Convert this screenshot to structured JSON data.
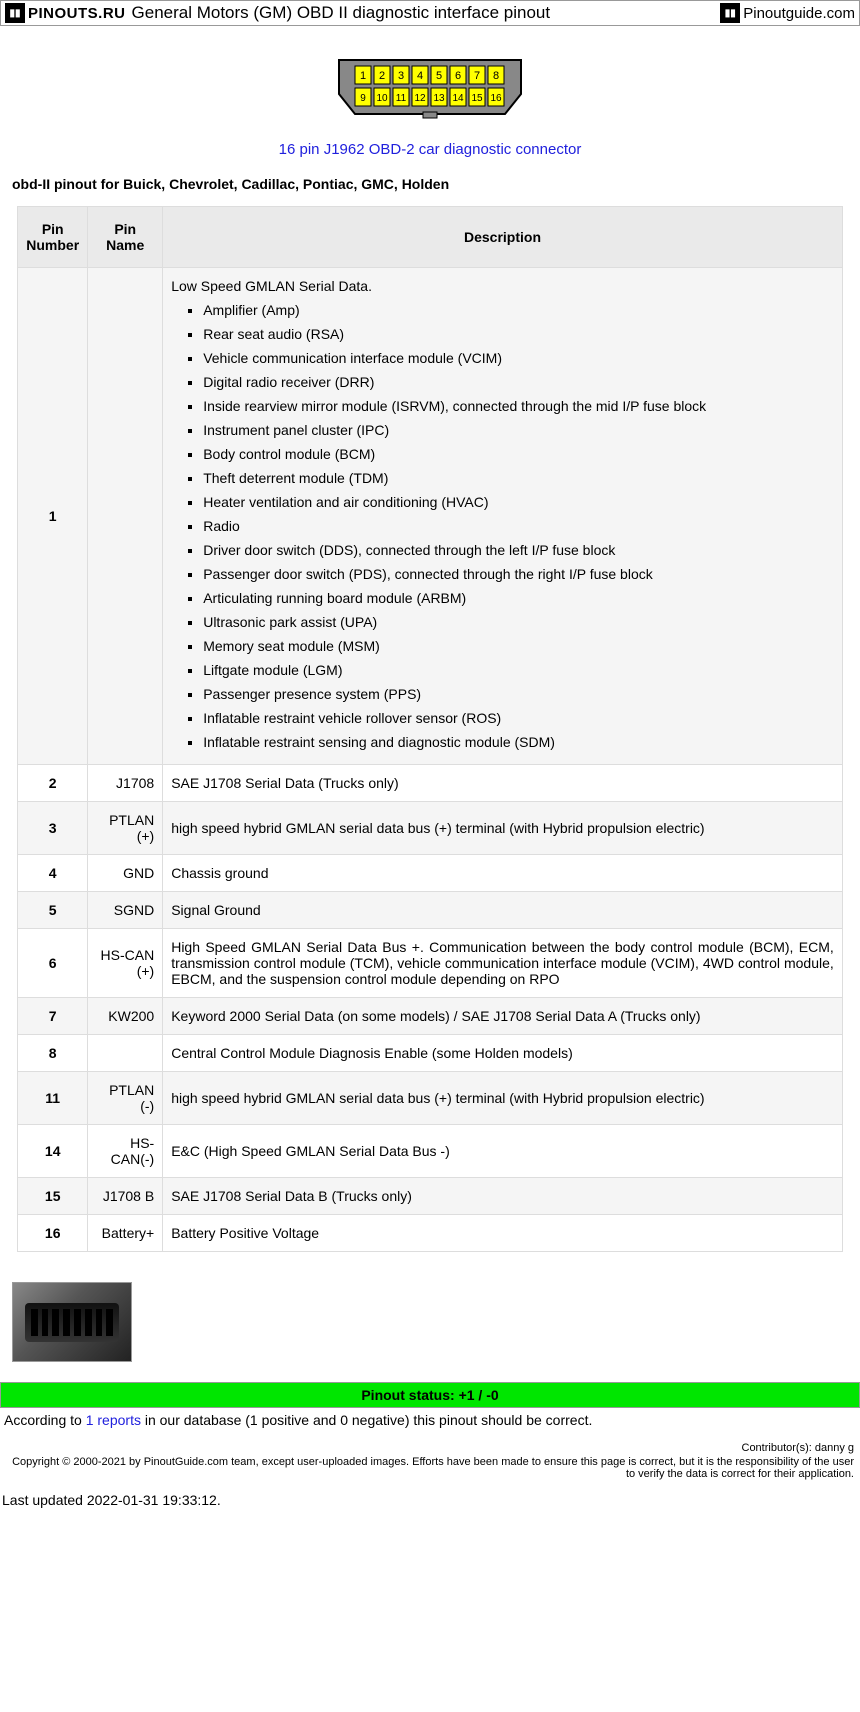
{
  "header": {
    "logo_left": "PINOUTS.RU",
    "title": "General Motors (GM) OBD II diagnostic interface pinout",
    "logo_right_a": "Pinout",
    "logo_right_b": "guide",
    "logo_right_c": ".com"
  },
  "connector": {
    "pins_top": [
      "1",
      "2",
      "3",
      "4",
      "5",
      "6",
      "7",
      "8"
    ],
    "pins_bottom": [
      "9",
      "10",
      "11",
      "12",
      "13",
      "14",
      "15",
      "16"
    ],
    "link": "16 pin J1962 OBD-2 car diagnostic connector"
  },
  "subtitle": "obd-II pinout for Buick, Chevrolet, Cadillac, Pontiac, GMC, Holden",
  "table": {
    "headers": {
      "num": "Pin Number",
      "name": "Pin Name",
      "desc": "Description"
    },
    "rows": [
      {
        "num": "1",
        "name": "",
        "intro": "Low Speed GMLAN Serial Data.",
        "items": [
          "Amplifier (Amp)",
          "Rear seat audio (RSA)",
          "Vehicle communication interface module (VCIM)",
          "Digital radio receiver (DRR)",
          "Inside rearview mirror module (ISRVM), connected through the mid I/P fuse block",
          "Instrument panel cluster (IPC)",
          "Body control module (BCM)",
          "Theft deterrent module (TDM)",
          "Heater ventilation and air conditioning (HVAC)",
          "Radio",
          "Driver door switch (DDS), connected through the left I/P fuse block",
          "Passenger door switch (PDS), connected through the right I/P fuse block",
          "Articulating running board module (ARBM)",
          "Ultrasonic park assist (UPA)",
          "Memory seat module (MSM)",
          "Liftgate module (LGM)",
          "Passenger presence system (PPS)",
          "Inflatable restraint vehicle rollover sensor (ROS)",
          "Inflatable restraint sensing and diagnostic module (SDM)"
        ]
      },
      {
        "num": "2",
        "name": "J1708",
        "desc": "SAE J1708 Serial Data (Trucks only)"
      },
      {
        "num": "3",
        "name": "PTLAN (+)",
        "desc": "high speed hybrid GMLAN serial data bus (+) terminal  (with Hybrid propulsion electric)"
      },
      {
        "num": "4",
        "name": "GND",
        "desc": "Chassis ground"
      },
      {
        "num": "5",
        "name": "SGND",
        "desc": "Signal Ground"
      },
      {
        "num": "6",
        "name": "HS-CAN (+)",
        "desc": "High Speed GMLAN Serial Data Bus +. Communication between the body control module (BCM), ECM, transmission control module (TCM), vehicle communication interface module (VCIM), 4WD control module, EBCM, and the suspension control module depending on RPO"
      },
      {
        "num": "7",
        "name": "KW200",
        "desc": "Keyword 2000 Serial Data (on some models) / SAE J1708 Serial Data A (Trucks only)"
      },
      {
        "num": "8",
        "name": "",
        "desc": "Central Control Module Diagnosis Enable (some Holden models)"
      },
      {
        "num": "11",
        "name": "PTLAN (-)",
        "desc": "high speed hybrid GMLAN serial data bus (+) terminal  (with Hybrid propulsion electric)"
      },
      {
        "num": "14",
        "name": "HS-CAN(-)",
        "desc": "E&C (High Speed GMLAN Serial Data Bus -)"
      },
      {
        "num": "15",
        "name": "J1708 B",
        "desc": "SAE J1708 Serial Data B (Trucks only)"
      },
      {
        "num": "16",
        "name": "Battery+",
        "desc": "Battery Positive Voltage"
      }
    ]
  },
  "status": {
    "bar": "Pinout status: +1 / -0",
    "desc_a": "According to ",
    "desc_link": "1 reports",
    "desc_b": " in our database (1 positive and 0 negative) this pinout should be correct."
  },
  "footer": {
    "contrib": "Contributor(s): danny g",
    "copyright": "Copyright © 2000-2021 by PinoutGuide.com team, except user-uploaded images. Efforts have been made to ensure this page is correct, but it is the responsibility of the user to verify the data is correct for their application.",
    "updated": "Last updated 2022-01-31 19:33:12."
  }
}
